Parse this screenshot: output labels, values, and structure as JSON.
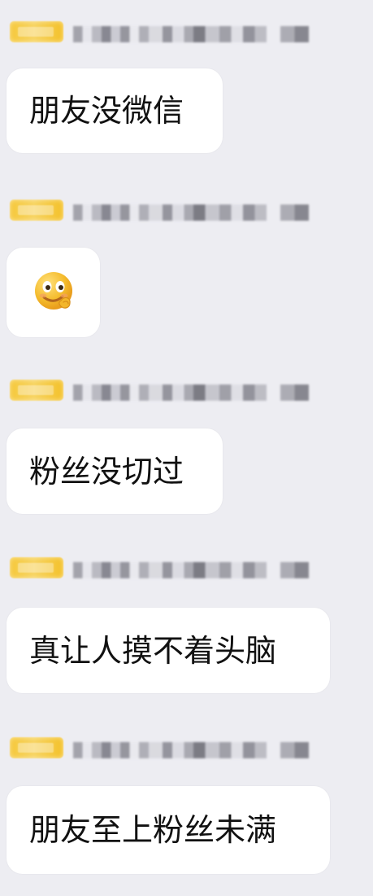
{
  "messages": [
    {
      "text": "朋友没微信",
      "type": "text"
    },
    {
      "type": "emoji",
      "emoji": "smiling-face-emoji"
    },
    {
      "text": "粉丝没切过",
      "type": "text"
    },
    {
      "text": "真让人摸不着头脑",
      "type": "text"
    },
    {
      "text": "朋友至上粉丝未满",
      "type": "text"
    }
  ],
  "colors": {
    "background": "#ededf2",
    "bubble": "#ffffff",
    "badge": "#f6c83a",
    "text": "#111111"
  }
}
